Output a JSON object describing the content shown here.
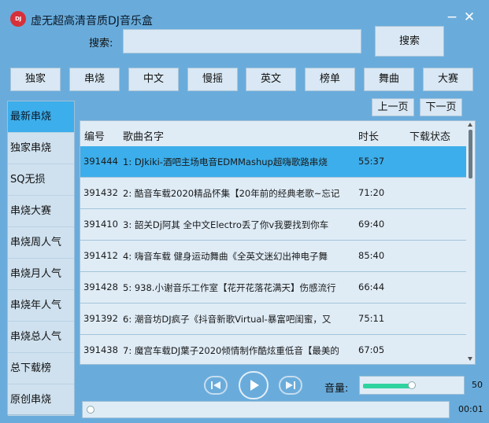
{
  "window": {
    "logo_text": "DJ",
    "title": "虚无超高清音质DJ音乐盒",
    "minimize": "−",
    "close": "✕"
  },
  "search": {
    "label": "搜索:",
    "value": "",
    "placeholder": "",
    "button": "搜索"
  },
  "categories": [
    "独家",
    "串烧",
    "中文",
    "慢摇",
    "英文",
    "榜单",
    "舞曲",
    "大赛"
  ],
  "pager": {
    "prev": "上一页",
    "next": "下一页"
  },
  "sidebar": {
    "active_index": 0,
    "items": [
      "最新串烧",
      "独家串烧",
      "SQ无损",
      "串烧大赛",
      "串烧周人气",
      "串烧月人气",
      "串烧年人气",
      "串烧总人气",
      "总下载榜",
      "原创串烧"
    ]
  },
  "table": {
    "headers": {
      "id": "编号",
      "name": "歌曲名字",
      "duration": "时长",
      "download": "下载状态"
    },
    "selected_index": 0,
    "rows": [
      {
        "id": "391444",
        "name": "1: DJkiki-酒吧主场电音EDMMashup超嗨歌路串烧",
        "duration": "55:37",
        "download": ""
      },
      {
        "id": "391432",
        "name": "2: 酷音车载2020精品怀集【20年前的经典老歌~忘记",
        "duration": "71:20",
        "download": ""
      },
      {
        "id": "391410",
        "name": "3: 韶关Dj阿其 全中文Electro丢了你v我要找到你车",
        "duration": "69:40",
        "download": ""
      },
      {
        "id": "391412",
        "name": "4: 嗨音车载 健身运动舞曲《全英文迷幻出神电子舞",
        "duration": "85:40",
        "download": ""
      },
      {
        "id": "391428",
        "name": "5: 938.小谢音乐工作室【花开花落花满天】伤感流行",
        "duration": "66:44",
        "download": ""
      },
      {
        "id": "391392",
        "name": "6: 潮音坊DJ疯子《抖音新歌Virtual-暴富吧闺蜜，又",
        "duration": "75:11",
        "download": ""
      },
      {
        "id": "391438",
        "name": "7: 魔宫车载DJ葉子2020倾情制作酷炫重低音【最美的",
        "duration": "67:05",
        "download": ""
      }
    ]
  },
  "player": {
    "prev_icon": "skip-back-icon",
    "play_icon": "play-icon",
    "next_icon": "skip-forward-icon",
    "volume_label": "音量:",
    "volume": 50,
    "volume_text": "50",
    "progress_fraction": 0.0,
    "time": "00:01"
  },
  "colors": {
    "window_bg": "#69acdc",
    "selected": "#3caeeb",
    "volume_fill": "#2fd39e",
    "logo": "#d6313a"
  }
}
